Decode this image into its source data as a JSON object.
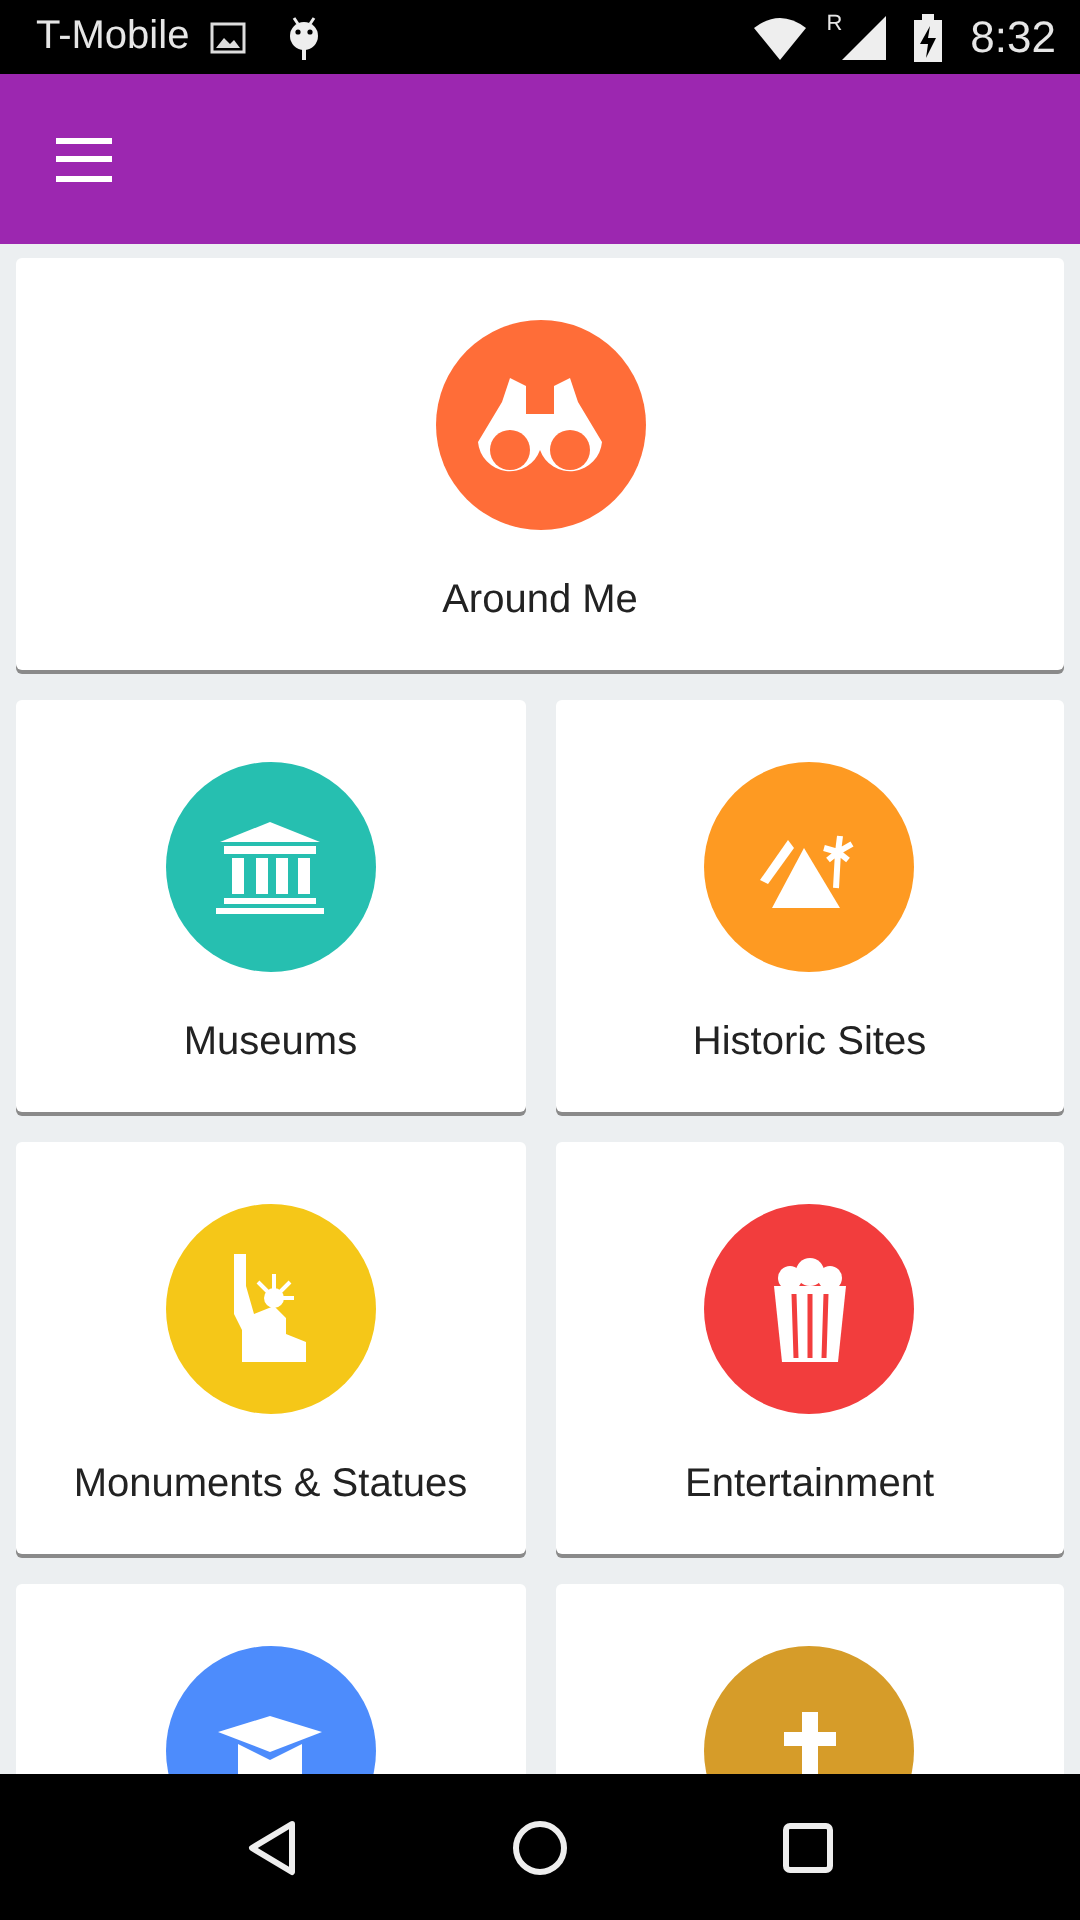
{
  "status_bar": {
    "carrier": "T-Mobile",
    "roaming": "R",
    "time": "8:32"
  },
  "featured": {
    "label": "Around Me",
    "kind": "binoculars",
    "color": "#ff6d38"
  },
  "categories": [
    {
      "label": "Museums",
      "kind": "museum",
      "color": "#26bfb0"
    },
    {
      "label": "Historic Sites",
      "kind": "pyramid",
      "color": "#fe9a22"
    },
    {
      "label": "Monuments & Statues",
      "kind": "statue",
      "color": "#f5c718"
    },
    {
      "label": "Entertainment",
      "kind": "popcorn",
      "color": "#f23d3d"
    },
    {
      "kind": "graduation",
      "color": "#4d8cfc"
    },
    {
      "kind": "cross",
      "color": "#d69c29"
    }
  ]
}
